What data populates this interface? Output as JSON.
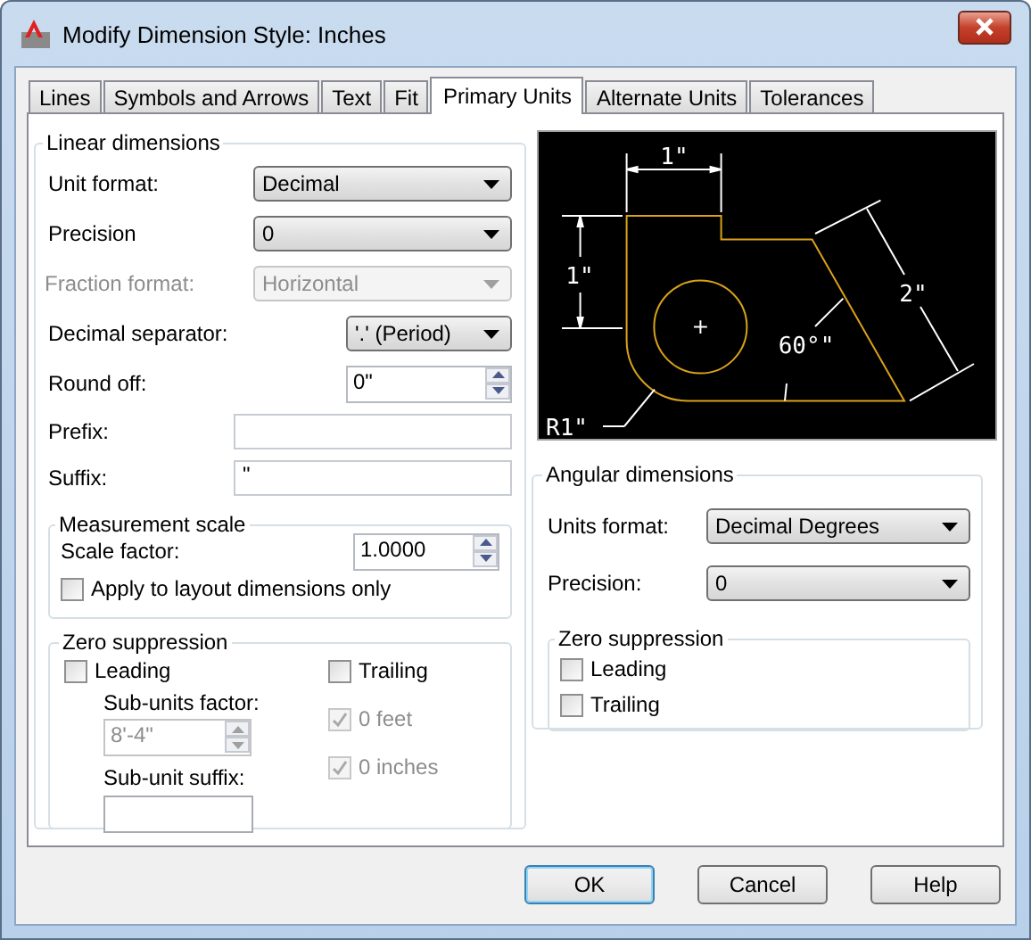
{
  "window": {
    "title": "Modify Dimension Style: Inches"
  },
  "tabs": [
    {
      "label": "Lines",
      "selected": false
    },
    {
      "label": "Symbols and Arrows",
      "selected": false
    },
    {
      "label": "Text",
      "selected": false
    },
    {
      "label": "Fit",
      "selected": false
    },
    {
      "label": "Primary Units",
      "selected": true
    },
    {
      "label": "Alternate Units",
      "selected": false
    },
    {
      "label": "Tolerances",
      "selected": false
    }
  ],
  "linear_dimensions": {
    "title": "Linear dimensions",
    "fields": [
      {
        "kind": "dropdown",
        "label": "Unit format:",
        "value": "Decimal",
        "disabled": false
      },
      {
        "kind": "dropdown",
        "label": "Precision",
        "value": "0",
        "disabled": false
      },
      {
        "kind": "dropdown",
        "label": "Fraction format:",
        "value": "Horizontal",
        "disabled": true
      },
      {
        "kind": "dropdown",
        "label": "Decimal separator:",
        "value": "'.' (Period)",
        "disabled": false
      },
      {
        "kind": "spinner",
        "label": "Round off:",
        "value": "0\""
      },
      {
        "kind": "text",
        "label": "Prefix:"
      },
      {
        "kind": "text",
        "label": "Suffix:",
        "value": "\""
      }
    ]
  },
  "measurement_scale": {
    "title": "Measurement scale",
    "scale_factor": {
      "label": "Scale factor:",
      "value": "1.0000"
    },
    "layout_only": {
      "label": "Apply to layout dimensions only",
      "checked": false
    }
  },
  "zero_suppression": {
    "title": "Zero suppression",
    "leading": {
      "label": "Leading",
      "checked": false
    },
    "sub_units_factor": {
      "label": "Sub-units factor:",
      "value": "8'-4\"",
      "disabled": true
    },
    "sub_unit_suffix": {
      "label": "Sub-unit suffix:"
    },
    "trailing": {
      "label": "Trailing",
      "checked": false
    },
    "feet": {
      "label": "0 feet",
      "checked": true,
      "disabled": true
    },
    "inches": {
      "label": "0 inches",
      "checked": true,
      "disabled": true
    }
  },
  "preview": {
    "labels": [
      "1\"",
      "1\"",
      "2\"",
      "60°\"",
      "R1\""
    ]
  },
  "angular_dimensions": {
    "title": "Angular dimensions",
    "units_format": {
      "label": "Units format:",
      "value": "Decimal Degrees"
    },
    "precision": {
      "label": "Precision:",
      "value": "0"
    },
    "zero_suppression": {
      "title": "Zero suppression",
      "options": [
        {
          "label": "Leading",
          "checked": false
        },
        {
          "label": "Trailing",
          "checked": false
        }
      ]
    }
  },
  "buttons": [
    {
      "label": "OK",
      "default": true
    },
    {
      "label": "Cancel",
      "default": false
    },
    {
      "label": "Help",
      "default": false
    }
  ]
}
